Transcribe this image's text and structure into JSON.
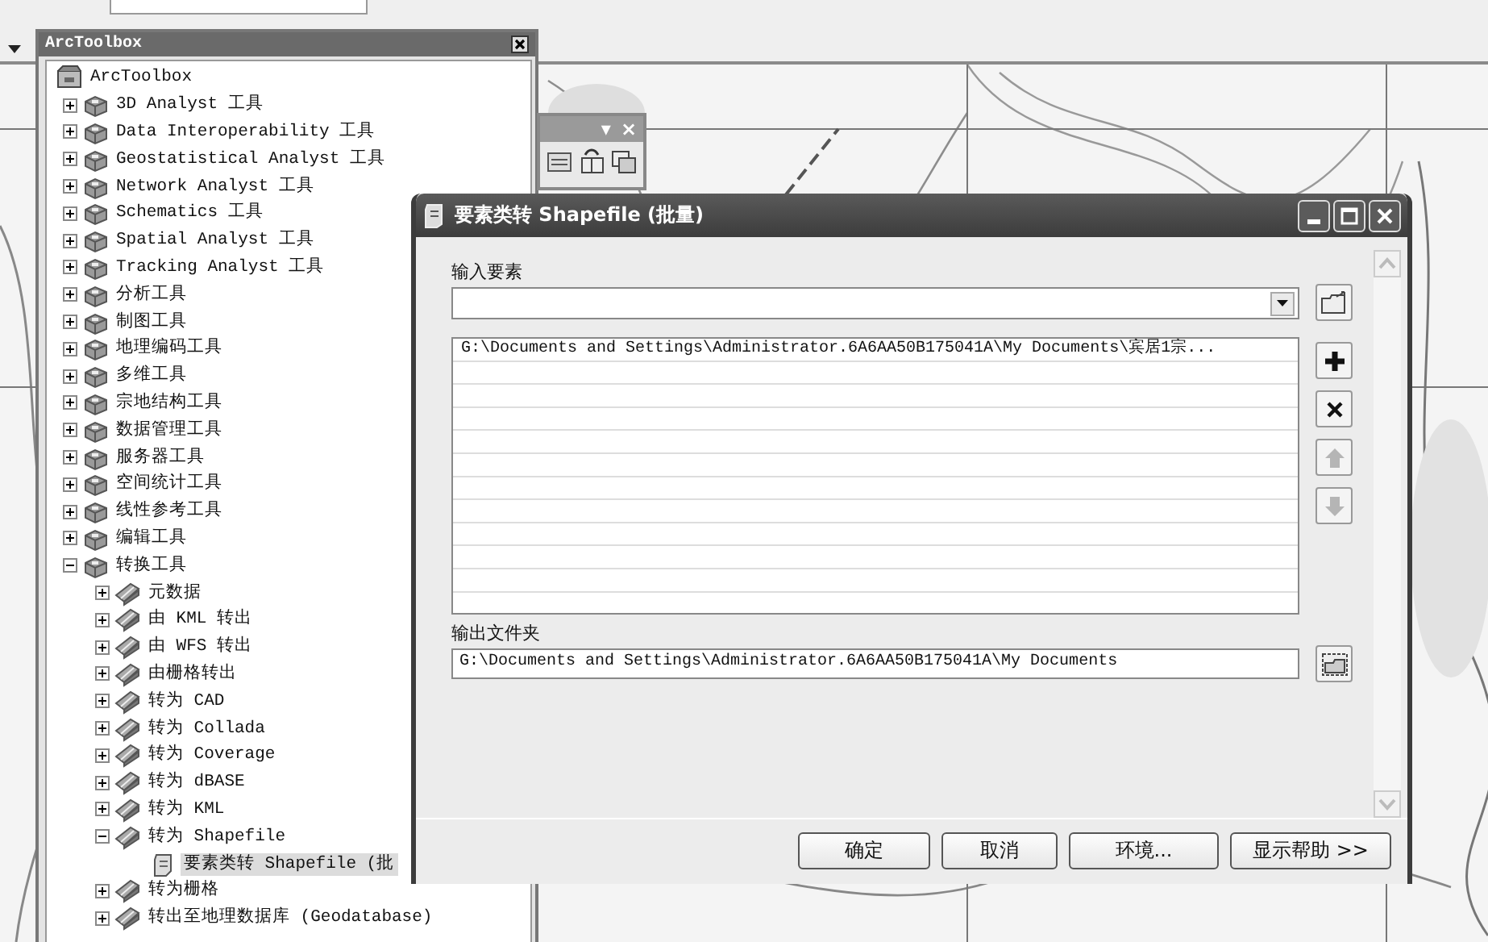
{
  "toolbox_panel": {
    "title": "ArcToolbox"
  },
  "tree": {
    "label": "ArcToolbox",
    "kind": "root",
    "selected": false,
    "children": [
      {
        "label": "3D Analyst 工具",
        "kind": "toolbox",
        "expanded": false,
        "selected": false
      },
      {
        "label": "Data Interoperability 工具",
        "kind": "toolbox",
        "expanded": false,
        "selected": false
      },
      {
        "label": "Geostatistical Analyst 工具",
        "kind": "toolbox",
        "expanded": false,
        "selected": false
      },
      {
        "label": "Network Analyst 工具",
        "kind": "toolbox",
        "expanded": false,
        "selected": false
      },
      {
        "label": "Schematics 工具",
        "kind": "toolbox",
        "expanded": false,
        "selected": false
      },
      {
        "label": "Spatial Analyst 工具",
        "kind": "toolbox",
        "expanded": false,
        "selected": false
      },
      {
        "label": "Tracking Analyst 工具",
        "kind": "toolbox",
        "expanded": false,
        "selected": false
      },
      {
        "label": "分析工具",
        "kind": "toolbox",
        "expanded": false,
        "selected": false
      },
      {
        "label": "制图工具",
        "kind": "toolbox",
        "expanded": false,
        "selected": false
      },
      {
        "label": "地理编码工具",
        "kind": "toolbox",
        "expanded": false,
        "selected": false
      },
      {
        "label": "多维工具",
        "kind": "toolbox",
        "expanded": false,
        "selected": false
      },
      {
        "label": "宗地结构工具",
        "kind": "toolbox",
        "expanded": false,
        "selected": false
      },
      {
        "label": "数据管理工具",
        "kind": "toolbox",
        "expanded": false,
        "selected": false
      },
      {
        "label": "服务器工具",
        "kind": "toolbox",
        "expanded": false,
        "selected": false
      },
      {
        "label": "空间统计工具",
        "kind": "toolbox",
        "expanded": false,
        "selected": false
      },
      {
        "label": "线性参考工具",
        "kind": "toolbox",
        "expanded": false,
        "selected": false
      },
      {
        "label": "编辑工具",
        "kind": "toolbox",
        "expanded": false,
        "selected": false
      },
      {
        "label": "转换工具",
        "kind": "toolbox",
        "expanded": true,
        "selected": false,
        "children": [
          {
            "label": "元数据",
            "kind": "toolset",
            "expanded": false,
            "selected": false
          },
          {
            "label": "由 KML 转出",
            "kind": "toolset",
            "expanded": false,
            "selected": false
          },
          {
            "label": "由 WFS 转出",
            "kind": "toolset",
            "expanded": false,
            "selected": false
          },
          {
            "label": "由栅格转出",
            "kind": "toolset",
            "expanded": false,
            "selected": false
          },
          {
            "label": "转为 CAD",
            "kind": "toolset",
            "expanded": false,
            "selected": false
          },
          {
            "label": "转为 Collada",
            "kind": "toolset",
            "expanded": false,
            "selected": false
          },
          {
            "label": "转为 Coverage",
            "kind": "toolset",
            "expanded": false,
            "selected": false
          },
          {
            "label": "转为 dBASE",
            "kind": "toolset",
            "expanded": false,
            "selected": false
          },
          {
            "label": "转为 KML",
            "kind": "toolset",
            "expanded": false,
            "selected": false
          },
          {
            "label": "转为 Shapefile",
            "kind": "toolset",
            "expanded": true,
            "selected": false,
            "children": [
              {
                "label": "要素类转 Shapefile (批",
                "kind": "tool",
                "selected": true
              }
            ]
          },
          {
            "label": "转为栅格",
            "kind": "toolset",
            "expanded": false,
            "selected": false
          },
          {
            "label": "转出至地理数据库 (Geodatabase)",
            "kind": "toolset",
            "expanded": false,
            "selected": false
          }
        ]
      }
    ]
  },
  "floating_toolbar": {
    "menu": "▾",
    "close": "×"
  },
  "dialog": {
    "title": "要素类转 Shapefile (批量)",
    "input_label": "输入要素",
    "items": [
      "G:\\Documents and Settings\\Administrator.6A6AA50B175041A\\My Documents\\宾居1宗..."
    ],
    "list_buttons": [
      {
        "kind": "add",
        "disabled": false
      },
      {
        "kind": "remove",
        "disabled": false
      },
      {
        "kind": "up",
        "disabled": true
      },
      {
        "kind": "down",
        "disabled": true
      }
    ],
    "output_label": "输出文件夹",
    "output_value": "G:\\Documents and Settings\\Administrator.6A6AA50B175041A\\My Documents",
    "buttons": [
      "确定",
      "取消",
      "环境...",
      "显示帮助 >>"
    ]
  }
}
